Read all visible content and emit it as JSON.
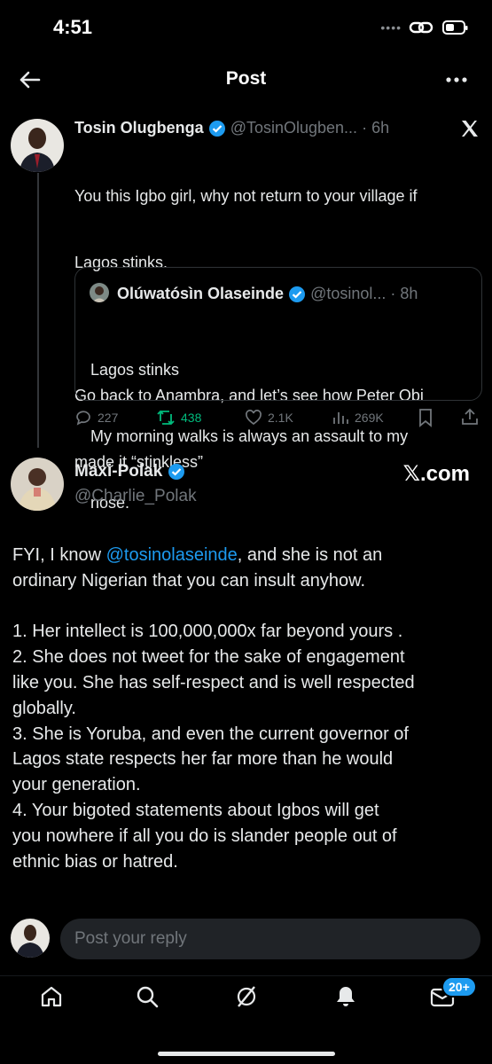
{
  "status": {
    "time": "4:51"
  },
  "header": {
    "title": "Post"
  },
  "parent_tweet": {
    "name": "Tosin Olugbenga",
    "handle": "@TosinOlugben...",
    "time": "· 6h",
    "text_line1": "You this Igbo girl, why not return to your village if",
    "text_line2": "Lagos stinks.",
    "text_line3": "Go back to Anambra, and let’s see how Peter Obi",
    "text_line4": "made it “stinkless”",
    "quote": {
      "name": "Olúwatósìn Olaseinde",
      "handle": "@tosinol...",
      "time": "· 8h",
      "line1": "Lagos stinks",
      "line2": "My morning walks is always an assault to my",
      "line3": "nose."
    },
    "actions": {
      "replies": "227",
      "reposts": "438",
      "likes": "2.1K",
      "views": "269K"
    }
  },
  "main_tweet": {
    "name": "Maxi-Polak",
    "handle": "@Charlie_Polak",
    "watermark": "𝕏.com",
    "lines": [
      [
        "FYI, I know ",
        "@tosinolaseinde",
        ", and she is not an"
      ],
      [
        "ordinary Nigerian that you can insult anyhow.",
        "",
        ""
      ],
      [
        "",
        "",
        ""
      ],
      [
        "1. Her intellect is 100,000,000x far beyond yours .",
        "",
        ""
      ],
      [
        "2. She does not tweet for the sake of engagement",
        "",
        ""
      ],
      [
        "like you. She has self-respect and is well respected",
        "",
        ""
      ],
      [
        "globally.",
        "",
        ""
      ],
      [
        "3. She is Yoruba, and even the current governor of",
        "",
        ""
      ],
      [
        "Lagos state respects her far more than he would",
        "",
        ""
      ],
      [
        "your generation.",
        "",
        ""
      ],
      [
        "4. Your bigoted statements about Igbos will get",
        "",
        ""
      ],
      [
        "you nowhere if all you do is slander people out of",
        "",
        ""
      ],
      [
        "ethnic bias or hatred.",
        "",
        ""
      ]
    ]
  },
  "reply": {
    "placeholder": "Post your reply"
  },
  "nav": {
    "badge": "20+"
  },
  "colors": {
    "accent": "#1d9bf0",
    "repost_green": "#00ba7c",
    "background": "#000000"
  }
}
